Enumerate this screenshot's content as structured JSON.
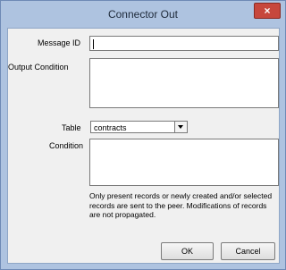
{
  "window": {
    "title": "Connector Out",
    "close_label": "×"
  },
  "form": {
    "message_id": {
      "label": "Message ID",
      "value": ""
    },
    "output_condition": {
      "label": "Output Condition",
      "value": ""
    },
    "table": {
      "label": "Table",
      "value": "contracts"
    },
    "condition": {
      "label": "Condition",
      "value": ""
    },
    "note": "Only present records or newly created and/or selected records are sent to the peer. Modifications of records are not propagated."
  },
  "buttons": {
    "ok": "OK",
    "cancel": "Cancel"
  }
}
